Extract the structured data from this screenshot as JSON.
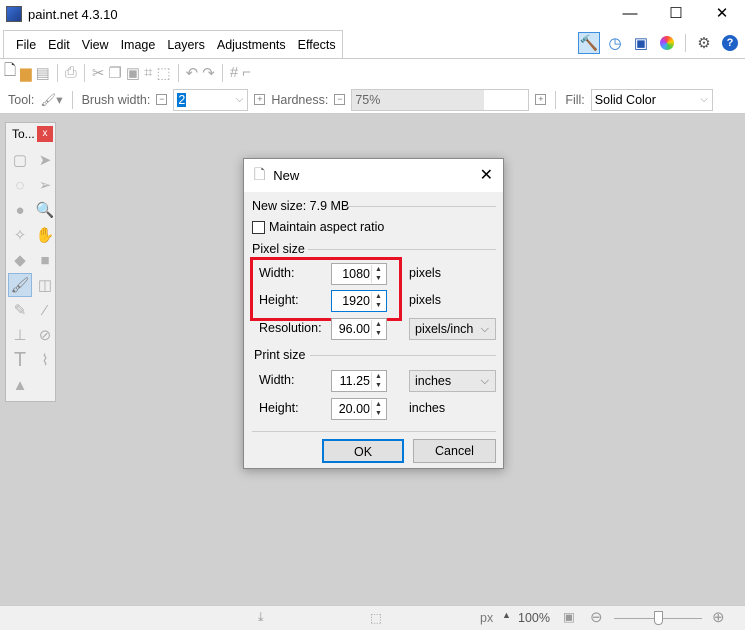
{
  "app": {
    "title": "paint.net 4.3.10"
  },
  "window_controls": {
    "minimize": "—",
    "maximize": "☐",
    "close": "✕"
  },
  "menu": [
    "File",
    "Edit",
    "View",
    "Image",
    "Layers",
    "Adjustments",
    "Effects"
  ],
  "tool_options": {
    "tool_label": "Tool:",
    "brush_width_label": "Brush width:",
    "brush_width_value": "2",
    "hardness_label": "Hardness:",
    "hardness_value": "75%",
    "fill_label": "Fill:",
    "fill_value": "Solid Color"
  },
  "tools_window": {
    "title": "To...",
    "close": "x"
  },
  "dialog": {
    "title": "New",
    "new_size": "New size: 7.9 MB",
    "maintain_aspect": "Maintain aspect ratio",
    "maintain_checked": false,
    "pixel_size_label": "Pixel size",
    "width_label": "Width:",
    "width_value": "1080",
    "width_unit": "pixels",
    "height_label": "Height:",
    "height_value": "1920",
    "height_unit": "pixels",
    "resolution_label": "Resolution:",
    "resolution_value": "96.00",
    "resolution_unit": "pixels/inch",
    "print_size_label": "Print size",
    "print_width_label": "Width:",
    "print_width_value": "11.25",
    "print_width_unit": "inches",
    "print_height_label": "Height:",
    "print_height_value": "20.00",
    "print_height_unit": "inches",
    "ok": "OK",
    "cancel": "Cancel"
  },
  "status": {
    "units": "px",
    "zoom": "100%",
    "zoom_level_fraction": 0.5
  },
  "colors": {
    "highlight": "#e81123",
    "focus": "#0078d7"
  }
}
